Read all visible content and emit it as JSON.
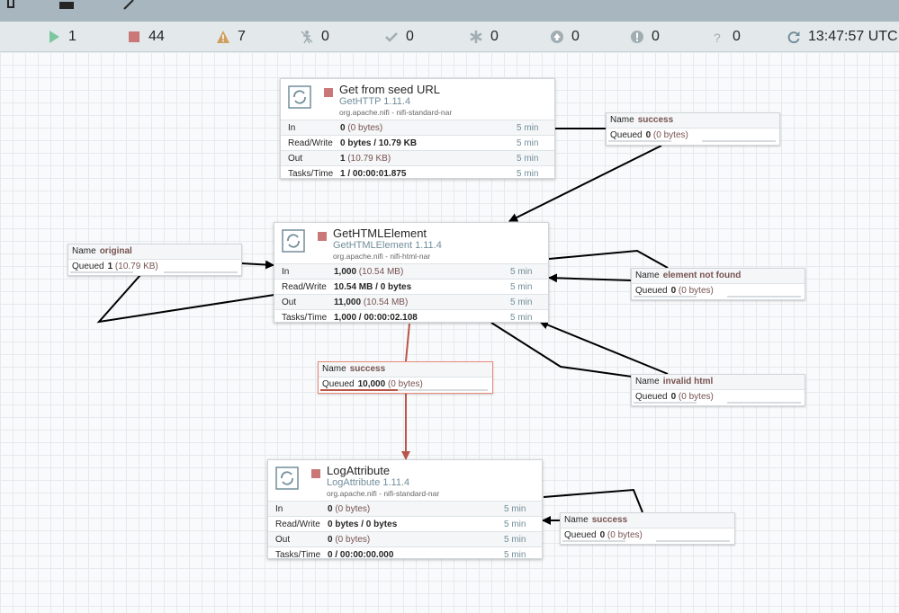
{
  "toolbar": {
    "icons": [
      "template-icon",
      "upload-icon",
      "label-icon"
    ]
  },
  "status": {
    "running": "1",
    "stopped": "44",
    "invalid": "7",
    "disabled": "0",
    "up_to_date": "0",
    "locally_modified": "0",
    "stale": "0",
    "sync_failure": "0",
    "unknown": "0",
    "time": "13:47:57 UTC"
  },
  "processors": [
    {
      "name": "Get from seed URL",
      "type": "GetHTTP 1.11.4",
      "bundle": "org.apache.nifi - nifi-standard-nar",
      "rows": [
        {
          "label": "In",
          "bold": "0",
          "extra": " (0 bytes)",
          "time": "5 min"
        },
        {
          "label": "Read/Write",
          "bold": "0 bytes / 10.79 KB",
          "extra": "",
          "time": "5 min"
        },
        {
          "label": "Out",
          "bold": "1",
          "extra": " (10.79 KB)",
          "time": "5 min"
        },
        {
          "label": "Tasks/Time",
          "bold": "1 / 00:00:01.875",
          "extra": "",
          "time": "5 min"
        }
      ]
    },
    {
      "name": "GetHTMLElement",
      "type": "GetHTMLElement 1.11.4",
      "bundle": "org.apache.nifi - nifi-html-nar",
      "rows": [
        {
          "label": "In",
          "bold": "1,000",
          "extra": " (10.54 MB)",
          "time": "5 min"
        },
        {
          "label": "Read/Write",
          "bold": "10.54 MB / 0 bytes",
          "extra": "",
          "time": "5 min"
        },
        {
          "label": "Out",
          "bold": "11,000",
          "extra": " (10.54 MB)",
          "time": "5 min"
        },
        {
          "label": "Tasks/Time",
          "bold": "1,000 / 00:00:02.108",
          "extra": "",
          "time": "5 min"
        }
      ]
    },
    {
      "name": "LogAttribute",
      "type": "LogAttribute 1.11.4",
      "bundle": "org.apache.nifi - nifi-standard-nar",
      "rows": [
        {
          "label": "In",
          "bold": "0",
          "extra": " (0 bytes)",
          "time": "5 min"
        },
        {
          "label": "Read/Write",
          "bold": "0 bytes / 0 bytes",
          "extra": "",
          "time": "5 min"
        },
        {
          "label": "Out",
          "bold": "0",
          "extra": " (0 bytes)",
          "time": "5 min"
        },
        {
          "label": "Tasks/Time",
          "bold": "0 / 00:00:00.000",
          "extra": "",
          "time": "5 min"
        }
      ]
    }
  ],
  "connections": [
    {
      "name_label": "Name",
      "name": "success",
      "queued_label": "Queued",
      "count": "0",
      "size": " (0 bytes)"
    },
    {
      "name_label": "Name",
      "name": "original",
      "queued_label": "Queued",
      "count": "1",
      "size": " (10.79 KB)"
    },
    {
      "name_label": "Name",
      "name": "element not found",
      "queued_label": "Queued",
      "count": "0",
      "size": " (0 bytes)"
    },
    {
      "name_label": "Name",
      "name": "success",
      "queued_label": "Queued",
      "count": "10,000",
      "size": " (0 bytes)"
    },
    {
      "name_label": "Name",
      "name": "invalid html",
      "queued_label": "Queued",
      "count": "0",
      "size": " (0 bytes)"
    },
    {
      "name_label": "Name",
      "name": "success",
      "queued_label": "Queued",
      "count": "0",
      "size": " (0 bytes)"
    }
  ],
  "colors": {
    "accent_red": "#ba554a",
    "stopped": "#c97777",
    "running": "#7dc7a0",
    "warning": "#cf9f5d"
  }
}
